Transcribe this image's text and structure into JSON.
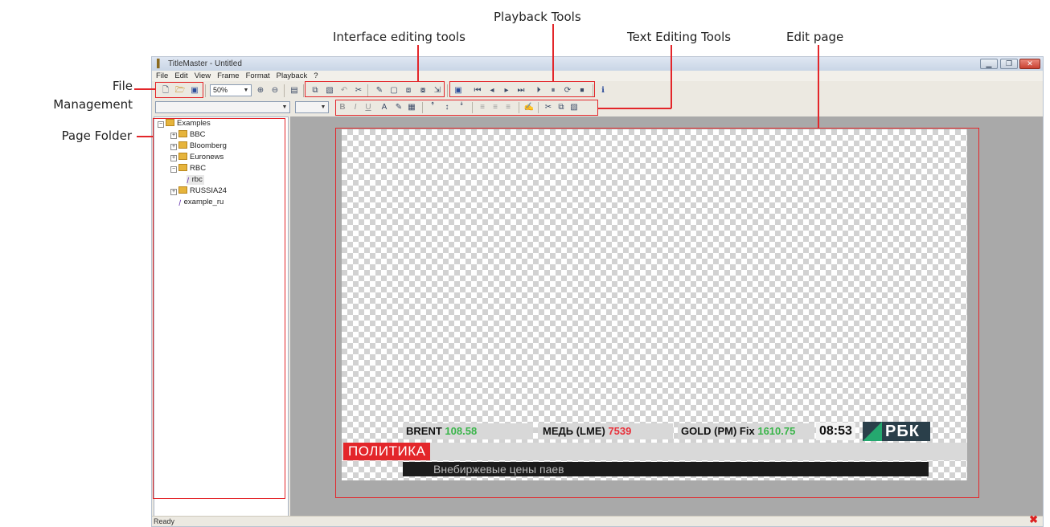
{
  "annotations": {
    "playback_tools": "Playback Tools",
    "interface_editing_tools": "Interface editing tools",
    "text_editing_tools": "Text Editing Tools",
    "edit_page": "Edit page",
    "file_management_line1": "File",
    "file_management_line2": "Management",
    "page_folder": "Page Folder"
  },
  "window": {
    "title": "TitleMaster - Untitled",
    "menu": [
      "File",
      "Edit",
      "View",
      "Frame",
      "Format",
      "Playback",
      "?"
    ],
    "zoom": "50%"
  },
  "tree": {
    "root": "Examples",
    "items": [
      "BBC",
      "Bloomberg",
      "Euronews",
      "RBC",
      "rbc",
      "RUSSIA24",
      "example_ru"
    ]
  },
  "canvas": {
    "ticker": [
      {
        "label": "BRENT",
        "value": "108.58"
      },
      {
        "label": "МЕДЬ (LME)",
        "value": "7539"
      },
      {
        "label": "GOLD (PM) Fix",
        "value": "1610.75"
      }
    ],
    "clock": "08:53",
    "logo": "РБК",
    "category": "ПОЛИТИКА",
    "news": "Внебиржевые цены паев"
  },
  "status": {
    "ready": "Ready"
  },
  "icons": {
    "app": "titlemaster-icon",
    "error": "error-x-icon"
  },
  "colors": {
    "annotation_red": "#e3262a",
    "ticker_up": "#3ab54a",
    "ticker_down": "#e8303a",
    "logo_green": "#25a86f"
  }
}
